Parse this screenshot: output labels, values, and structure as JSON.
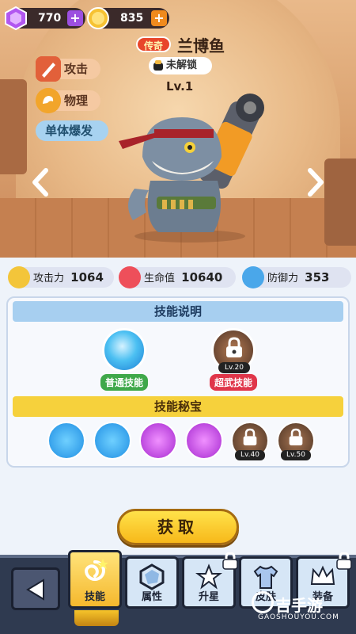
{
  "resources": {
    "gems": "770",
    "coins": "835",
    "gem_plus": "+",
    "coin_plus": "+"
  },
  "hero": {
    "rarity": "传奇",
    "name": "兰博鱼",
    "lock_status": "未解锁",
    "level": "Lv.1",
    "tags": {
      "attack_type": "攻击",
      "damage_type": "物理",
      "skill_type": "单体爆发"
    }
  },
  "stats": {
    "attack_label": "攻击力",
    "attack_value": "1064",
    "hp_label": "生命值",
    "hp_value": "10640",
    "defense_label": "防御力",
    "defense_value": "353"
  },
  "skills": {
    "header": "技能说明",
    "normal_label": "普通技能",
    "super_label": "超武技能",
    "super_level": "Lv.20"
  },
  "treasures": {
    "header": "技能秘宝",
    "locked_levels": [
      "Lv.40",
      "Lv.50"
    ]
  },
  "acquire_button": "获取",
  "nav": {
    "skills": "技能",
    "attributes": "属性",
    "star_up": "升星",
    "skin": "皮肤",
    "gear": "装备"
  },
  "watermark": {
    "brand": "吉手游",
    "url": "GAOSHOUYOU.COM"
  },
  "colors": {
    "accent_gold": "#f7b81a",
    "rarity_red": "#e8462b",
    "panel_blue": "#a7cff0",
    "nav_dark": "#2f3a50"
  }
}
